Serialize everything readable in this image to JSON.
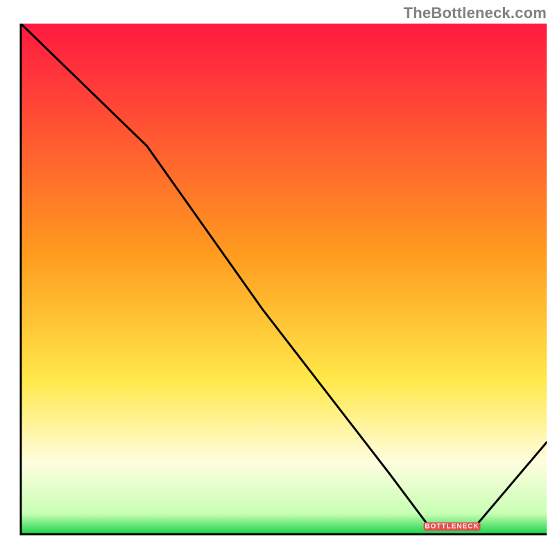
{
  "watermark": "TheBottleneck.com",
  "axes": {
    "xlim": [
      0,
      100
    ],
    "ylim": [
      0,
      100
    ],
    "show_ticks": false,
    "show_labels": false,
    "border_color": "#000000",
    "border_px": 3
  },
  "gradient": {
    "dir": "vertical",
    "stops": [
      {
        "pct": 0,
        "color": "#ff1a40"
      },
      {
        "pct": 12,
        "color": "#ff3a3a"
      },
      {
        "pct": 45,
        "color": "#ff9b1e"
      },
      {
        "pct": 70,
        "color": "#ffe94a"
      },
      {
        "pct": 86,
        "color": "#fffde0"
      },
      {
        "pct": 96,
        "color": "#c8ffb4"
      },
      {
        "pct": 100,
        "color": "#1ad24a"
      }
    ]
  },
  "chart_data": {
    "type": "line",
    "title": "",
    "xlabel": "",
    "ylabel": "",
    "xlim": [
      0,
      100
    ],
    "ylim": [
      0,
      100
    ],
    "series": [
      {
        "name": "bottleneck-curve",
        "x": [
          0,
          18,
          24,
          46,
          70,
          78,
          86,
          100
        ],
        "y": [
          100,
          82,
          76,
          44,
          12,
          1,
          1,
          18
        ]
      }
    ],
    "annotations": [
      {
        "name": "bottleneck-marker",
        "x": 82,
        "y": 1.5,
        "label": "BOTTLENECK",
        "color": "#e05050"
      }
    ]
  }
}
